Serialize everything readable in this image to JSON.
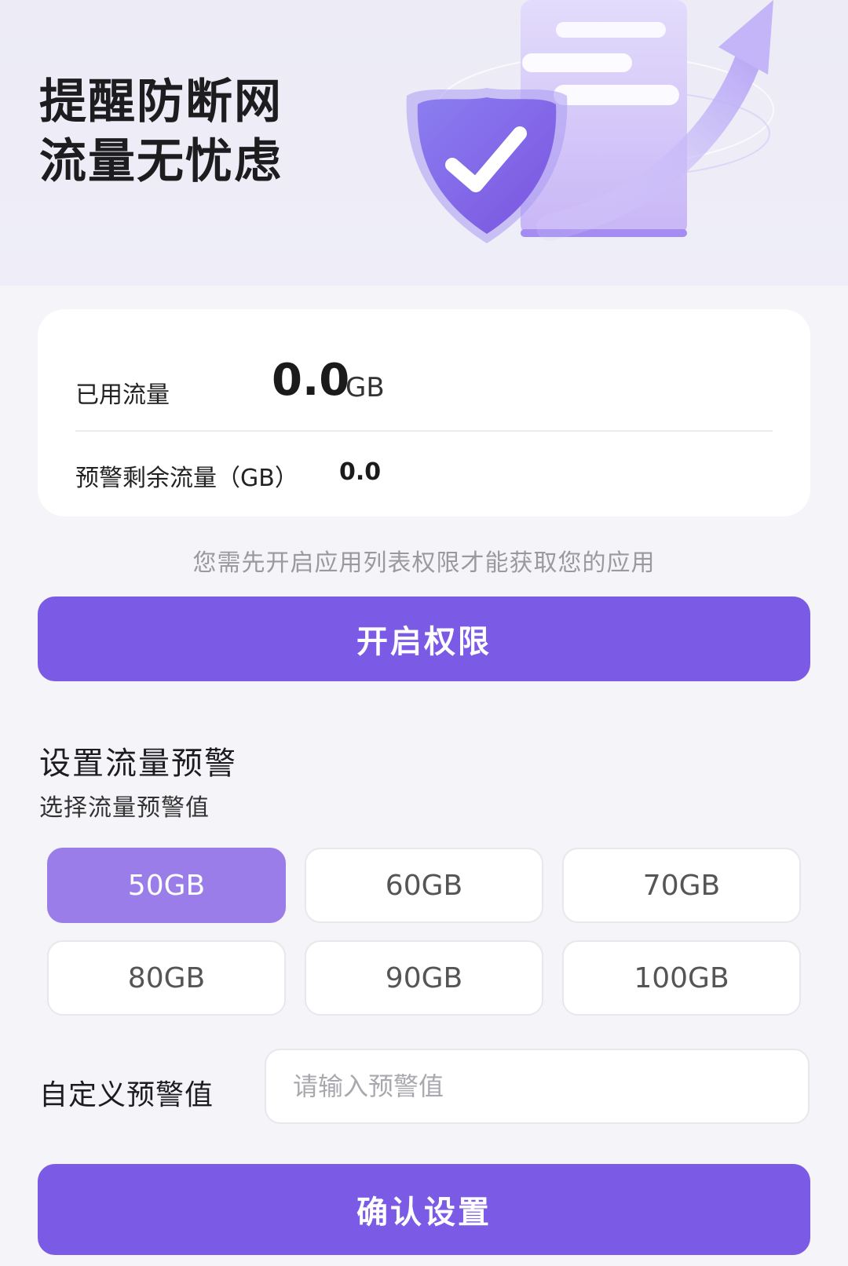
{
  "hero": {
    "title_line1": "提醒防断网",
    "title_line2": "流量无忧虑"
  },
  "usage": {
    "used_label": "已用流量",
    "used_value": "0.0",
    "used_unit": "GB",
    "remain_label": "预警剩余流量（GB）",
    "remain_value": "0.0"
  },
  "permission": {
    "hint": "您需先开启应用列表权限才能获取您的应用",
    "button_label": "开启权限"
  },
  "warning": {
    "title": "设置流量预警",
    "subtitle": "选择流量预警值",
    "options": [
      "50GB",
      "60GB",
      "70GB",
      "80GB",
      "90GB",
      "100GB"
    ],
    "selected": "50GB",
    "custom_label": "自定义预警值",
    "custom_placeholder": "请输入预警值",
    "confirm_label": "确认设置"
  },
  "colors": {
    "accent": "#7b5ae6",
    "selected_option": "#9b7de9",
    "background": "#f5f4f9"
  }
}
